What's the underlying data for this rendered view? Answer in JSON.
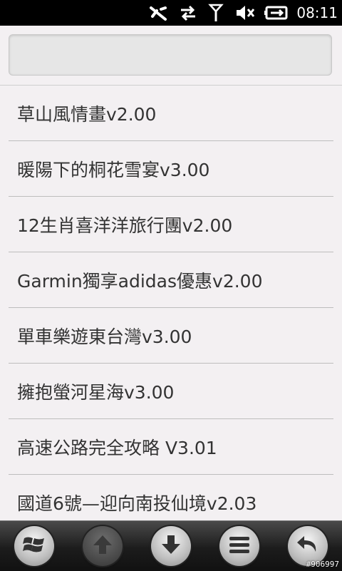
{
  "status_bar": {
    "time": "08:11",
    "icons": [
      "bluetooth-off-icon",
      "data-transfer-icon",
      "signal-icon",
      "volume-muted-icon",
      "battery-charging-icon"
    ]
  },
  "search": {
    "value": "",
    "placeholder": ""
  },
  "list": {
    "items": [
      {
        "label": "草山風情畫v2.00"
      },
      {
        "label": "暖陽下的桐花雪宴v3.00"
      },
      {
        "label": "12生肖喜洋洋旅行團v2.00"
      },
      {
        "label": "Garmin獨享adidas優惠v2.00"
      },
      {
        "label": "單車樂遊東台灣v3.00"
      },
      {
        "label": "擁抱螢河星海v3.00"
      },
      {
        "label": "高速公路完全攻略 V3.01"
      },
      {
        "label": "國道6號—迎向南投仙境v2.03"
      }
    ]
  },
  "toolbar": {
    "buttons": [
      {
        "icon": "windows-start-icon",
        "enabled": true
      },
      {
        "icon": "arrow-up-icon",
        "enabled": false
      },
      {
        "icon": "arrow-down-icon",
        "enabled": true
      },
      {
        "icon": "menu-icon",
        "enabled": true
      },
      {
        "icon": "back-icon",
        "enabled": true
      }
    ]
  },
  "watermark": "#906997"
}
